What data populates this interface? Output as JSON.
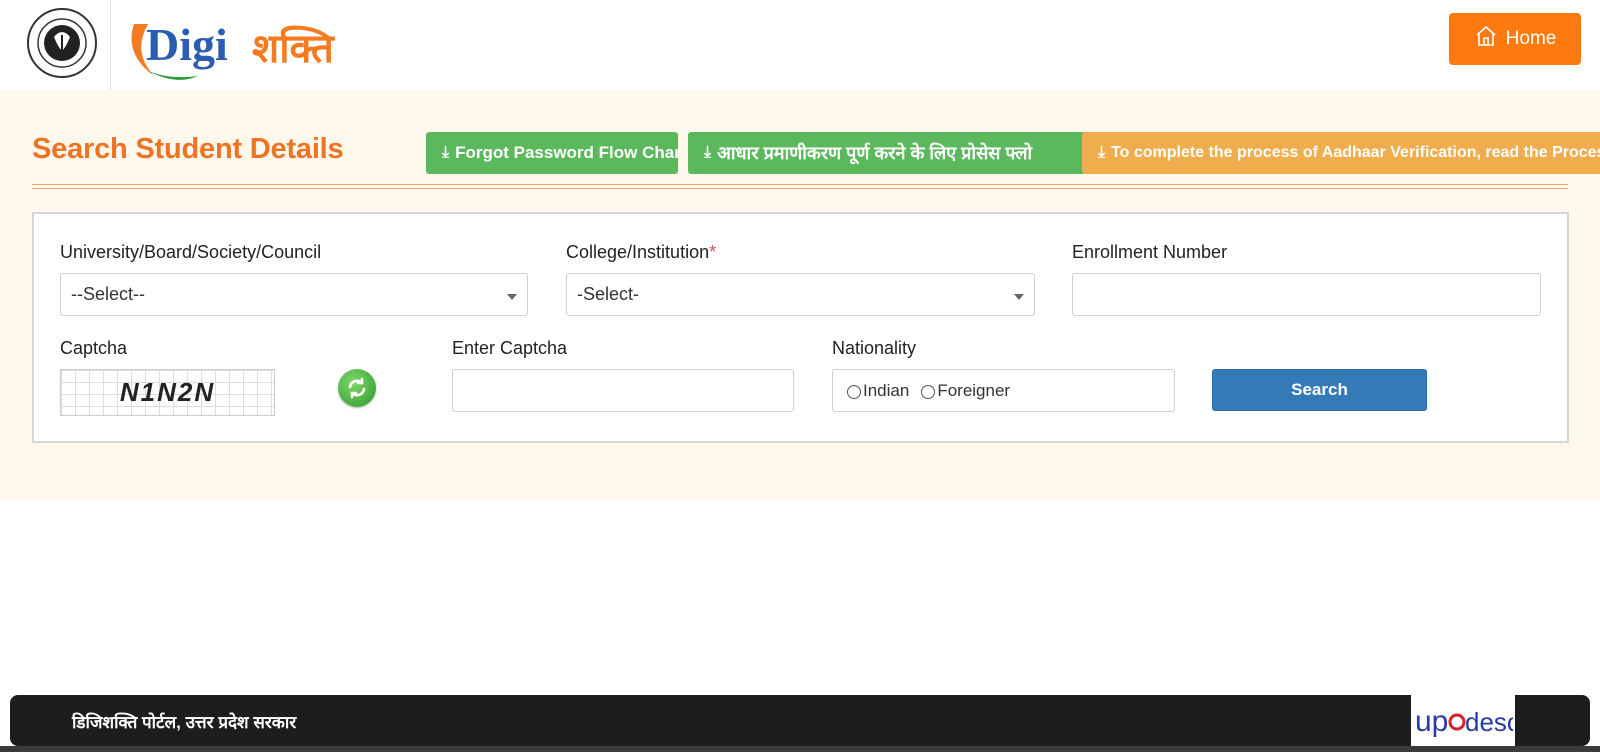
{
  "header": {
    "logo_latin": "Digi",
    "logo_devanagari": "शक्ति",
    "emblem_alt": "GOVERNMENT OF UTTAR PRADESH",
    "home_label": "Home"
  },
  "page": {
    "title": "Search Student Details",
    "buttons": {
      "forgot_password": "Forgot Password Flow Chart",
      "aadhaar_hindi": "आधार प्रमाणीकरण पूर्ण करने के लिए प्रोसेस फ्लो",
      "aadhaar_english": "To complete the process of Aadhaar Verification, read the Process Fl"
    }
  },
  "form": {
    "university_label": "University/Board/Society/Council",
    "university_value": "--Select--",
    "college_label": "College/Institution",
    "college_required": "*",
    "college_value": "-Select-",
    "enrollment_label": "Enrollment Number",
    "enrollment_value": "",
    "captcha_label": "Captcha",
    "captcha_text": "N1N2N",
    "enter_captcha_label": "Enter Captcha",
    "enter_captcha_value": "",
    "nationality_label": "Nationality",
    "nationality_options": [
      "Indian",
      "Foreigner"
    ],
    "search_label": "Search"
  },
  "footer": {
    "text": "डिजिशक्ति पोर्टल, उत्तर प्रदेश सरकार",
    "partner_logo_up": "up",
    "partner_logo_desco": "desco"
  },
  "colors": {
    "accent_orange": "#ef7322",
    "home_orange": "#ff7b10",
    "green_button": "#5cb85c",
    "amber_button": "#f0ad4e",
    "search_blue": "#337ab7",
    "band_bg": "#fff8ed"
  }
}
